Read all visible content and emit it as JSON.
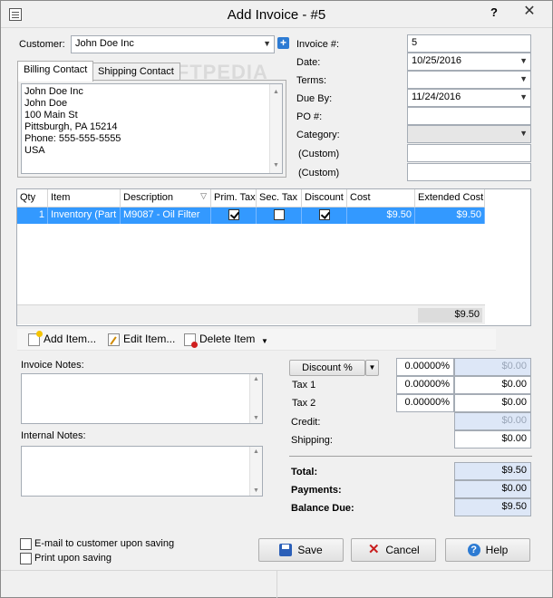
{
  "window": {
    "title": "Add Invoice - #5",
    "help_glyph": "?",
    "close_glyph": "✕"
  },
  "watermark": "SOFTPEDIA",
  "customer": {
    "label": "Customer:",
    "value": "John Doe Inc"
  },
  "tabs": [
    {
      "label": "Billing Contact"
    },
    {
      "label": "Shipping Contact"
    }
  ],
  "billing_address": [
    "John Doe Inc",
    "John Doe",
    "100 Main St",
    "Pittsburgh, PA  15214",
    "Phone: 555-555-5555",
    "USA"
  ],
  "invoice": {
    "number_label": "Invoice #:",
    "number": "5",
    "date_label": "Date:",
    "date": "10/25/2016",
    "terms_label": "Terms:",
    "terms": "",
    "due_label": "Due By:",
    "due": "11/24/2016",
    "po_label": "PO #:",
    "po": "",
    "category_label": "Category:",
    "category": "",
    "custom1_label": "(Custom)",
    "custom1": "",
    "custom2_label": "(Custom)",
    "custom2": ""
  },
  "items_table": {
    "columns": [
      "Qty",
      "Item",
      "Description",
      "Prim. Tax",
      "Sec. Tax",
      "Discount",
      "Cost",
      "Extended Cost"
    ],
    "rows": [
      {
        "qty": "1",
        "item": "Inventory (Part",
        "description": "M9087 - Oil Filter",
        "prim_tax": true,
        "sec_tax": false,
        "discount": true,
        "cost": "$9.50",
        "extended": "$9.50"
      }
    ],
    "total": "$9.50"
  },
  "toolbar": {
    "add": "Add Item...",
    "edit": "Edit Item...",
    "delete": "Delete Item"
  },
  "notes": {
    "invoice_label": "Invoice Notes:",
    "internal_label": "Internal Notes:"
  },
  "summary": {
    "discount_label": "Discount %",
    "discount_pct": "0.00000%",
    "discount_amt": "$0.00",
    "tax1_label": "Tax 1",
    "tax1_pct": "0.00000%",
    "tax1_amt": "$0.00",
    "tax2_label": "Tax 2",
    "tax2_pct": "0.00000%",
    "tax2_amt": "$0.00",
    "credit_label": "Credit:",
    "credit": "$0.00",
    "shipping_label": "Shipping:",
    "shipping": "$0.00",
    "total_label": "Total:",
    "total": "$9.50",
    "payments_label": "Payments:",
    "payments": "$0.00",
    "balance_label": "Balance Due:",
    "balance": "$9.50"
  },
  "options": {
    "email": "E-mail to customer upon saving",
    "print": "Print upon saving"
  },
  "buttons": {
    "save": "Save",
    "cancel": "Cancel",
    "help": "Help"
  },
  "icons": {
    "app": "invoice-app-icon",
    "add_contact": "plus-icon",
    "sort": "filter-triangle-icon"
  },
  "colors": {
    "selection": "#3399ff",
    "readonly_field": "#dde7f7",
    "accent": "#2d7bd3"
  }
}
